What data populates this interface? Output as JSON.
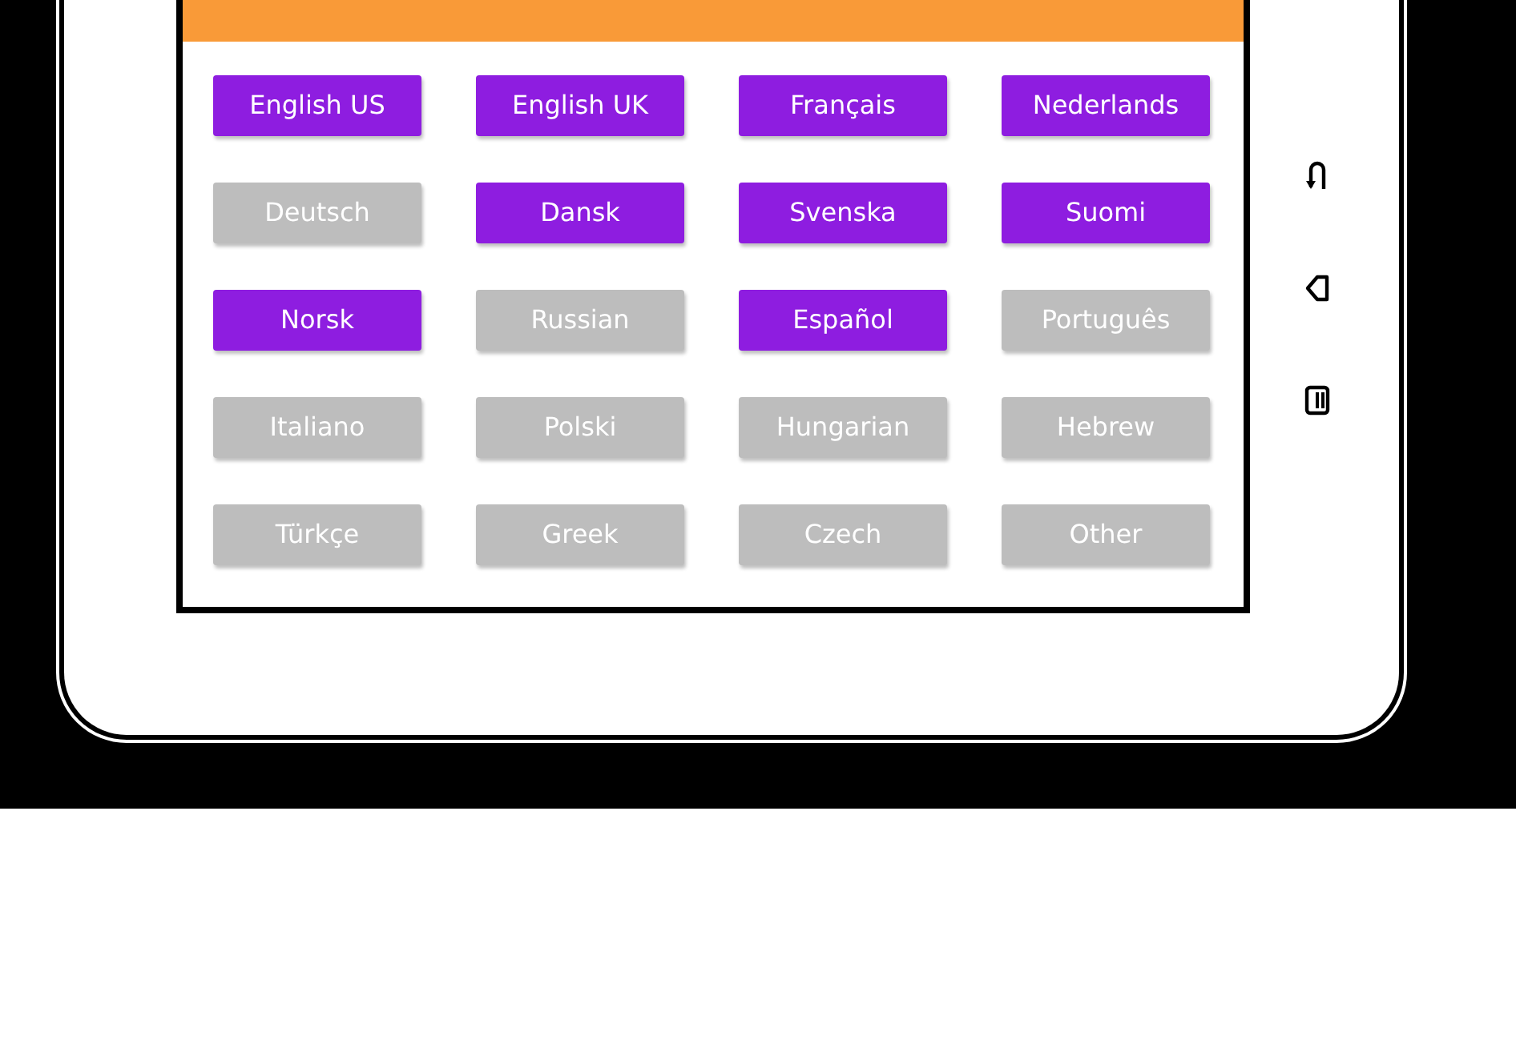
{
  "languages": [
    {
      "label": "English US",
      "selected": true
    },
    {
      "label": "English UK",
      "selected": true
    },
    {
      "label": "Français",
      "selected": true
    },
    {
      "label": "Nederlands",
      "selected": true
    },
    {
      "label": "Deutsch",
      "selected": false
    },
    {
      "label": "Dansk",
      "selected": true
    },
    {
      "label": "Svenska",
      "selected": true
    },
    {
      "label": "Suomi",
      "selected": true
    },
    {
      "label": "Norsk",
      "selected": true
    },
    {
      "label": "Russian",
      "selected": false
    },
    {
      "label": "Español",
      "selected": true
    },
    {
      "label": "Português",
      "selected": false
    },
    {
      "label": "Italiano",
      "selected": false
    },
    {
      "label": "Polski",
      "selected": false
    },
    {
      "label": "Hungarian",
      "selected": false
    },
    {
      "label": "Hebrew",
      "selected": false
    },
    {
      "label": "Türkçe",
      "selected": false
    },
    {
      "label": "Greek",
      "selected": false
    },
    {
      "label": "Czech",
      "selected": false
    },
    {
      "label": "Other",
      "selected": false
    }
  ]
}
